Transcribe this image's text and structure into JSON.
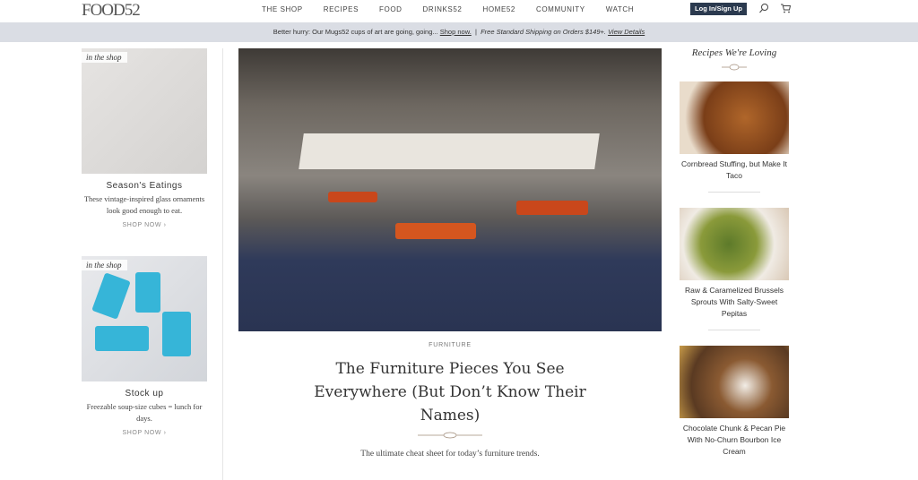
{
  "header": {
    "logo": "FOOD52",
    "nav": [
      "THE SHOP",
      "RECIPES",
      "FOOD",
      "DRINKS52",
      "HOME52",
      "COMMUNITY",
      "WATCH"
    ],
    "login": "Log In/Sign Up"
  },
  "banner": {
    "text": "Better hurry: Our Mugs52 cups of art are going, going...",
    "link": "Shop now.",
    "sep": "|",
    "shipping": "Free Standard Shipping on Orders $149+.",
    "details": "View Details"
  },
  "left": [
    {
      "tag": "in the shop",
      "title": "Season's Eatings",
      "desc": "These vintage-inspired glass ornaments look good enough to eat.",
      "cta": "SHOP NOW"
    },
    {
      "tag": "in the shop",
      "title": "Stock up",
      "desc": "Freezable soup-size cubes = lunch for days.",
      "cta": "SHOP NOW"
    }
  ],
  "main": {
    "kicker": "FURNITURE",
    "title": "The Furniture Pieces You See Everywhere (But Don’t Know Their Names)",
    "subtitle": "The ultimate cheat sheet for today’s furniture trends."
  },
  "right": {
    "heading": "Recipes We're Loving",
    "items": [
      {
        "title": "Cornbread Stuffing, but Make It Taco"
      },
      {
        "title": "Raw & Caramelized Brussels Sprouts With Salty-Sweet Pepitas"
      },
      {
        "title": "Chocolate Chunk & Pecan Pie With No-Churn Bourbon Ice Cream"
      }
    ]
  },
  "colors": {
    "login_bg": "#2b3a4f",
    "banner_bg": "#dadde4"
  }
}
